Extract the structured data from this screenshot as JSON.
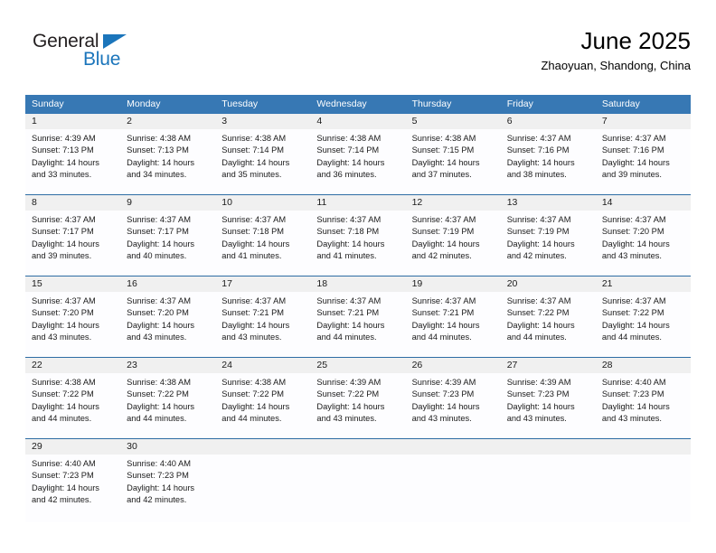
{
  "logo": {
    "text_top": "General",
    "text_bottom": "Blue",
    "triangle_icon": "triangle-icon",
    "color_dark": "#231f20",
    "color_blue": "#1b75bb"
  },
  "header": {
    "title": "June 2025",
    "location": "Zhaoyuan, Shandong, China"
  },
  "theme": {
    "header_blue": "#3778b4",
    "row_divider_blue": "#2e6da4",
    "daynum_band_gray": "#f0f0f0",
    "cell_white": "#fdfdff"
  },
  "weekdays": [
    "Sunday",
    "Monday",
    "Tuesday",
    "Wednesday",
    "Thursday",
    "Friday",
    "Saturday"
  ],
  "weeks": [
    {
      "days": [
        {
          "num": "1",
          "sunrise": "Sunrise: 4:39 AM",
          "sunset": "Sunset: 7:13 PM",
          "daylight1": "Daylight: 14 hours",
          "daylight2": "and 33 minutes."
        },
        {
          "num": "2",
          "sunrise": "Sunrise: 4:38 AM",
          "sunset": "Sunset: 7:13 PM",
          "daylight1": "Daylight: 14 hours",
          "daylight2": "and 34 minutes."
        },
        {
          "num": "3",
          "sunrise": "Sunrise: 4:38 AM",
          "sunset": "Sunset: 7:14 PM",
          "daylight1": "Daylight: 14 hours",
          "daylight2": "and 35 minutes."
        },
        {
          "num": "4",
          "sunrise": "Sunrise: 4:38 AM",
          "sunset": "Sunset: 7:14 PM",
          "daylight1": "Daylight: 14 hours",
          "daylight2": "and 36 minutes."
        },
        {
          "num": "5",
          "sunrise": "Sunrise: 4:38 AM",
          "sunset": "Sunset: 7:15 PM",
          "daylight1": "Daylight: 14 hours",
          "daylight2": "and 37 minutes."
        },
        {
          "num": "6",
          "sunrise": "Sunrise: 4:37 AM",
          "sunset": "Sunset: 7:16 PM",
          "daylight1": "Daylight: 14 hours",
          "daylight2": "and 38 minutes."
        },
        {
          "num": "7",
          "sunrise": "Sunrise: 4:37 AM",
          "sunset": "Sunset: 7:16 PM",
          "daylight1": "Daylight: 14 hours",
          "daylight2": "and 39 minutes."
        }
      ]
    },
    {
      "days": [
        {
          "num": "8",
          "sunrise": "Sunrise: 4:37 AM",
          "sunset": "Sunset: 7:17 PM",
          "daylight1": "Daylight: 14 hours",
          "daylight2": "and 39 minutes."
        },
        {
          "num": "9",
          "sunrise": "Sunrise: 4:37 AM",
          "sunset": "Sunset: 7:17 PM",
          "daylight1": "Daylight: 14 hours",
          "daylight2": "and 40 minutes."
        },
        {
          "num": "10",
          "sunrise": "Sunrise: 4:37 AM",
          "sunset": "Sunset: 7:18 PM",
          "daylight1": "Daylight: 14 hours",
          "daylight2": "and 41 minutes."
        },
        {
          "num": "11",
          "sunrise": "Sunrise: 4:37 AM",
          "sunset": "Sunset: 7:18 PM",
          "daylight1": "Daylight: 14 hours",
          "daylight2": "and 41 minutes."
        },
        {
          "num": "12",
          "sunrise": "Sunrise: 4:37 AM",
          "sunset": "Sunset: 7:19 PM",
          "daylight1": "Daylight: 14 hours",
          "daylight2": "and 42 minutes."
        },
        {
          "num": "13",
          "sunrise": "Sunrise: 4:37 AM",
          "sunset": "Sunset: 7:19 PM",
          "daylight1": "Daylight: 14 hours",
          "daylight2": "and 42 minutes."
        },
        {
          "num": "14",
          "sunrise": "Sunrise: 4:37 AM",
          "sunset": "Sunset: 7:20 PM",
          "daylight1": "Daylight: 14 hours",
          "daylight2": "and 43 minutes."
        }
      ]
    },
    {
      "days": [
        {
          "num": "15",
          "sunrise": "Sunrise: 4:37 AM",
          "sunset": "Sunset: 7:20 PM",
          "daylight1": "Daylight: 14 hours",
          "daylight2": "and 43 minutes."
        },
        {
          "num": "16",
          "sunrise": "Sunrise: 4:37 AM",
          "sunset": "Sunset: 7:20 PM",
          "daylight1": "Daylight: 14 hours",
          "daylight2": "and 43 minutes."
        },
        {
          "num": "17",
          "sunrise": "Sunrise: 4:37 AM",
          "sunset": "Sunset: 7:21 PM",
          "daylight1": "Daylight: 14 hours",
          "daylight2": "and 43 minutes."
        },
        {
          "num": "18",
          "sunrise": "Sunrise: 4:37 AM",
          "sunset": "Sunset: 7:21 PM",
          "daylight1": "Daylight: 14 hours",
          "daylight2": "and 44 minutes."
        },
        {
          "num": "19",
          "sunrise": "Sunrise: 4:37 AM",
          "sunset": "Sunset: 7:21 PM",
          "daylight1": "Daylight: 14 hours",
          "daylight2": "and 44 minutes."
        },
        {
          "num": "20",
          "sunrise": "Sunrise: 4:37 AM",
          "sunset": "Sunset: 7:22 PM",
          "daylight1": "Daylight: 14 hours",
          "daylight2": "and 44 minutes."
        },
        {
          "num": "21",
          "sunrise": "Sunrise: 4:37 AM",
          "sunset": "Sunset: 7:22 PM",
          "daylight1": "Daylight: 14 hours",
          "daylight2": "and 44 minutes."
        }
      ]
    },
    {
      "days": [
        {
          "num": "22",
          "sunrise": "Sunrise: 4:38 AM",
          "sunset": "Sunset: 7:22 PM",
          "daylight1": "Daylight: 14 hours",
          "daylight2": "and 44 minutes."
        },
        {
          "num": "23",
          "sunrise": "Sunrise: 4:38 AM",
          "sunset": "Sunset: 7:22 PM",
          "daylight1": "Daylight: 14 hours",
          "daylight2": "and 44 minutes."
        },
        {
          "num": "24",
          "sunrise": "Sunrise: 4:38 AM",
          "sunset": "Sunset: 7:22 PM",
          "daylight1": "Daylight: 14 hours",
          "daylight2": "and 44 minutes."
        },
        {
          "num": "25",
          "sunrise": "Sunrise: 4:39 AM",
          "sunset": "Sunset: 7:22 PM",
          "daylight1": "Daylight: 14 hours",
          "daylight2": "and 43 minutes."
        },
        {
          "num": "26",
          "sunrise": "Sunrise: 4:39 AM",
          "sunset": "Sunset: 7:23 PM",
          "daylight1": "Daylight: 14 hours",
          "daylight2": "and 43 minutes."
        },
        {
          "num": "27",
          "sunrise": "Sunrise: 4:39 AM",
          "sunset": "Sunset: 7:23 PM",
          "daylight1": "Daylight: 14 hours",
          "daylight2": "and 43 minutes."
        },
        {
          "num": "28",
          "sunrise": "Sunrise: 4:40 AM",
          "sunset": "Sunset: 7:23 PM",
          "daylight1": "Daylight: 14 hours",
          "daylight2": "and 43 minutes."
        }
      ]
    },
    {
      "days": [
        {
          "num": "29",
          "sunrise": "Sunrise: 4:40 AM",
          "sunset": "Sunset: 7:23 PM",
          "daylight1": "Daylight: 14 hours",
          "daylight2": "and 42 minutes."
        },
        {
          "num": "30",
          "sunrise": "Sunrise: 4:40 AM",
          "sunset": "Sunset: 7:23 PM",
          "daylight1": "Daylight: 14 hours",
          "daylight2": "and 42 minutes."
        },
        {
          "num": "",
          "sunrise": "",
          "sunset": "",
          "daylight1": "",
          "daylight2": ""
        },
        {
          "num": "",
          "sunrise": "",
          "sunset": "",
          "daylight1": "",
          "daylight2": ""
        },
        {
          "num": "",
          "sunrise": "",
          "sunset": "",
          "daylight1": "",
          "daylight2": ""
        },
        {
          "num": "",
          "sunrise": "",
          "sunset": "",
          "daylight1": "",
          "daylight2": ""
        },
        {
          "num": "",
          "sunrise": "",
          "sunset": "",
          "daylight1": "",
          "daylight2": ""
        }
      ]
    }
  ]
}
